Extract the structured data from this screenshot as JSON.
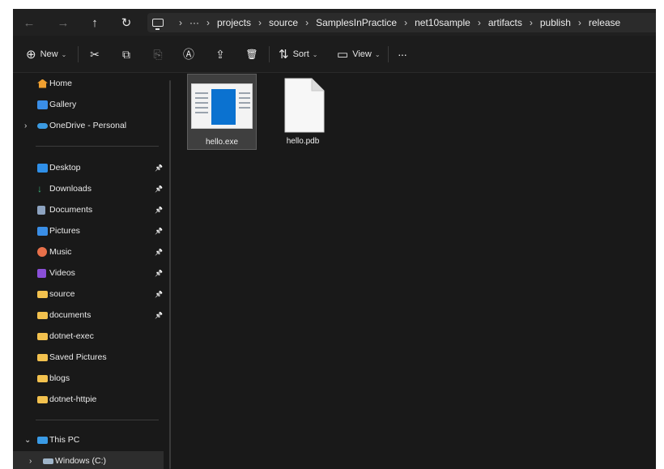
{
  "nav": {
    "back_icon": "arrow-left-icon",
    "forward_icon": "arrow-right-icon",
    "up_icon": "arrow-up-icon",
    "refresh_icon": "refresh-icon",
    "back_glyph": "←",
    "forward_glyph": "→",
    "up_glyph": "↑",
    "refresh_glyph": "↻"
  },
  "breadcrumb": {
    "overflow": "···",
    "separator": "›",
    "items": [
      "projects",
      "source",
      "SamplesInPractice",
      "net10sample",
      "artifacts",
      "publish",
      "release"
    ]
  },
  "toolbar": {
    "new_label": "New",
    "new_glyph": "⊕",
    "sort_label": "Sort",
    "sort_glyph": "⇅",
    "view_label": "View",
    "view_glyph": "▭",
    "chevron_glyph": "⌄",
    "more_glyph": "···",
    "cut_glyph": "✂",
    "copy_glyph": "⧉",
    "paste_glyph": "⎘",
    "rename_glyph": "Ⓐ",
    "share_glyph": "⇪",
    "delete_glyph": "🗑"
  },
  "sidebar": {
    "expander_collapsed": "›",
    "expander_expanded": "⌄",
    "pin_glyph": "📌",
    "top_items": [
      {
        "label": "Home",
        "icon": "home-icon",
        "color": "#f0a030"
      },
      {
        "label": "Gallery",
        "icon": "gallery-icon",
        "color": "#3a8ee6"
      },
      {
        "label": "OneDrive - Personal",
        "icon": "cloud-icon",
        "color": "#3b9ae1"
      }
    ],
    "quick_access": [
      {
        "label": "Desktop",
        "icon": "desktop-icon",
        "color": "#2f8fe8",
        "pinned": true
      },
      {
        "label": "Downloads",
        "icon": "download-icon",
        "color": "#3ab37a",
        "pinned": true
      },
      {
        "label": "Documents",
        "icon": "documents-icon",
        "color": "#8da3c0",
        "pinned": true
      },
      {
        "label": "Pictures",
        "icon": "pictures-icon",
        "color": "#3a8ee6",
        "pinned": true
      },
      {
        "label": "Music",
        "icon": "music-icon",
        "color": "#e8704a",
        "pinned": true
      },
      {
        "label": "Videos",
        "icon": "videos-icon",
        "color": "#8a4fd8",
        "pinned": true
      },
      {
        "label": "source",
        "icon": "folder-icon",
        "color": "#f2c14e",
        "pinned": true
      },
      {
        "label": "documents",
        "icon": "folder-icon",
        "color": "#f2c14e",
        "pinned": true
      },
      {
        "label": "dotnet-exec",
        "icon": "folder-icon",
        "color": "#f2c14e",
        "pinned": false
      },
      {
        "label": "Saved Pictures",
        "icon": "folder-icon",
        "color": "#f2c14e",
        "pinned": false
      },
      {
        "label": "blogs",
        "icon": "folder-icon",
        "color": "#f2c14e",
        "pinned": false
      },
      {
        "label": "dotnet-httpie",
        "icon": "folder-icon",
        "color": "#f2c14e",
        "pinned": false
      }
    ],
    "this_pc": {
      "label": "This PC",
      "icon": "computer-icon",
      "color": "#3a9be6"
    },
    "drive": {
      "label": "Windows (C:)",
      "icon": "drive-icon",
      "color": "#9fb4c8"
    }
  },
  "files": [
    {
      "name": "hello.exe",
      "icon": "executable-icon",
      "selected": true
    },
    {
      "name": "hello.pdb",
      "icon": "file-icon",
      "selected": false
    }
  ],
  "colors": {
    "window_bg": "#191919",
    "accent_blue": "#0b72d0",
    "folder_yellow": "#f2c14e"
  }
}
